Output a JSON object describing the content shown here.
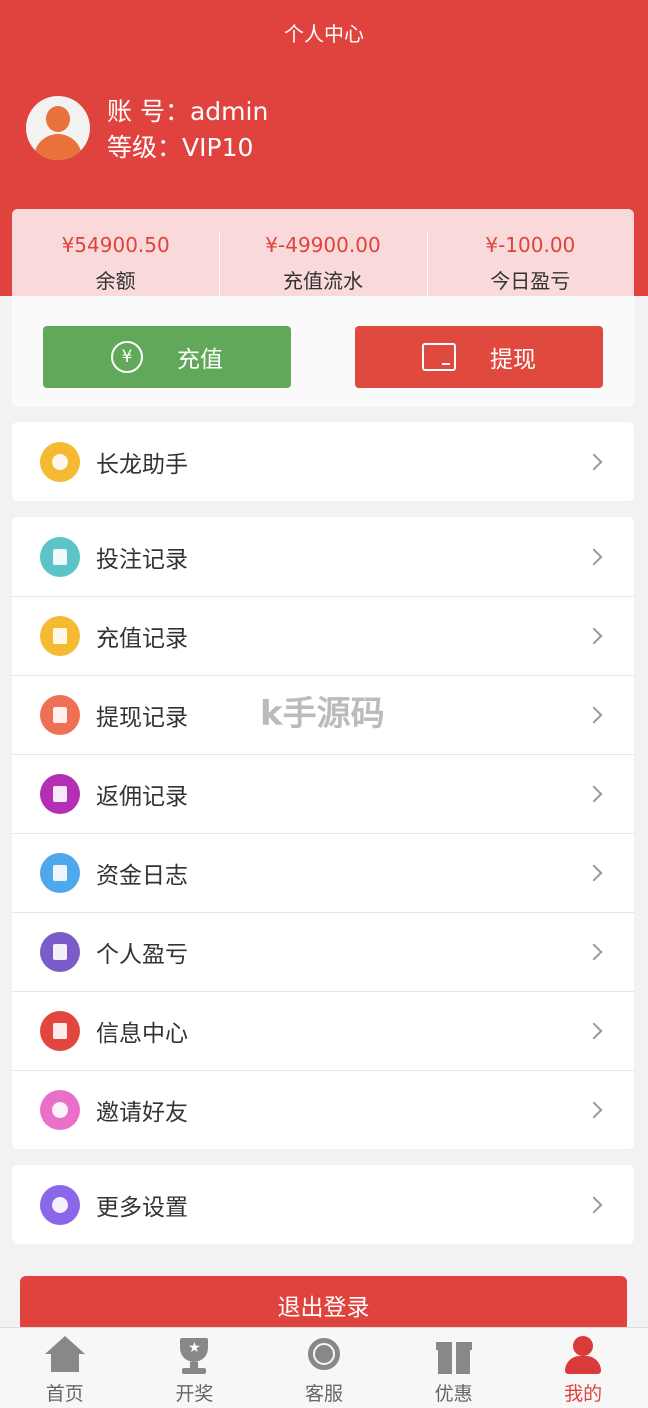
{
  "header": {
    "title": "个人中心"
  },
  "user": {
    "account_label": "账 号：",
    "account_value": "admin",
    "level_label": "等级：",
    "level_value": "VIP10"
  },
  "stats": [
    {
      "value": "¥54900.50",
      "label": "余额"
    },
    {
      "value": "¥-49900.00",
      "label": "充值流水"
    },
    {
      "value": "¥-100.00",
      "label": "今日盈亏"
    }
  ],
  "actions": {
    "recharge": {
      "label": "充值",
      "icon": "yen-coin-icon"
    },
    "withdraw": {
      "label": "提现",
      "icon": "wallet-icon"
    }
  },
  "menu_groups": [
    [
      {
        "label": "长龙助手",
        "icon": "lightbulb-icon",
        "color": "#f5b932"
      }
    ],
    [
      {
        "label": "投注记录",
        "icon": "clipboard-icon",
        "color": "#5cc3c6"
      },
      {
        "label": "充值记录",
        "icon": "document-icon",
        "color": "#f5b932"
      },
      {
        "label": "提现记录",
        "icon": "card-icon",
        "color": "#ee7055"
      },
      {
        "label": "返佣记录",
        "icon": "ledger-icon",
        "color": "#b42fb5"
      },
      {
        "label": "资金日志",
        "icon": "log-icon",
        "color": "#4fa7ec"
      },
      {
        "label": "个人盈亏",
        "icon": "bar-chart-icon",
        "color": "#7b5cc8"
      },
      {
        "label": "信息中心",
        "icon": "mail-icon",
        "color": "#e2473f"
      },
      {
        "label": "邀请好友",
        "icon": "invite-icon",
        "color": "#ea6fc8"
      }
    ],
    [
      {
        "label": "更多设置",
        "icon": "settings-grid-icon",
        "color": "#8a66e8"
      }
    ]
  ],
  "watermark": "k手源码",
  "logout_label": "退出登录",
  "tabs": [
    {
      "label": "首页",
      "icon": "home-icon",
      "active": false
    },
    {
      "label": "开奖",
      "icon": "trophy-icon",
      "active": false
    },
    {
      "label": "客服",
      "icon": "headset-icon",
      "active": false
    },
    {
      "label": "优惠",
      "icon": "gift-icon",
      "active": false
    },
    {
      "label": "我的",
      "icon": "user-icon",
      "active": true
    }
  ]
}
